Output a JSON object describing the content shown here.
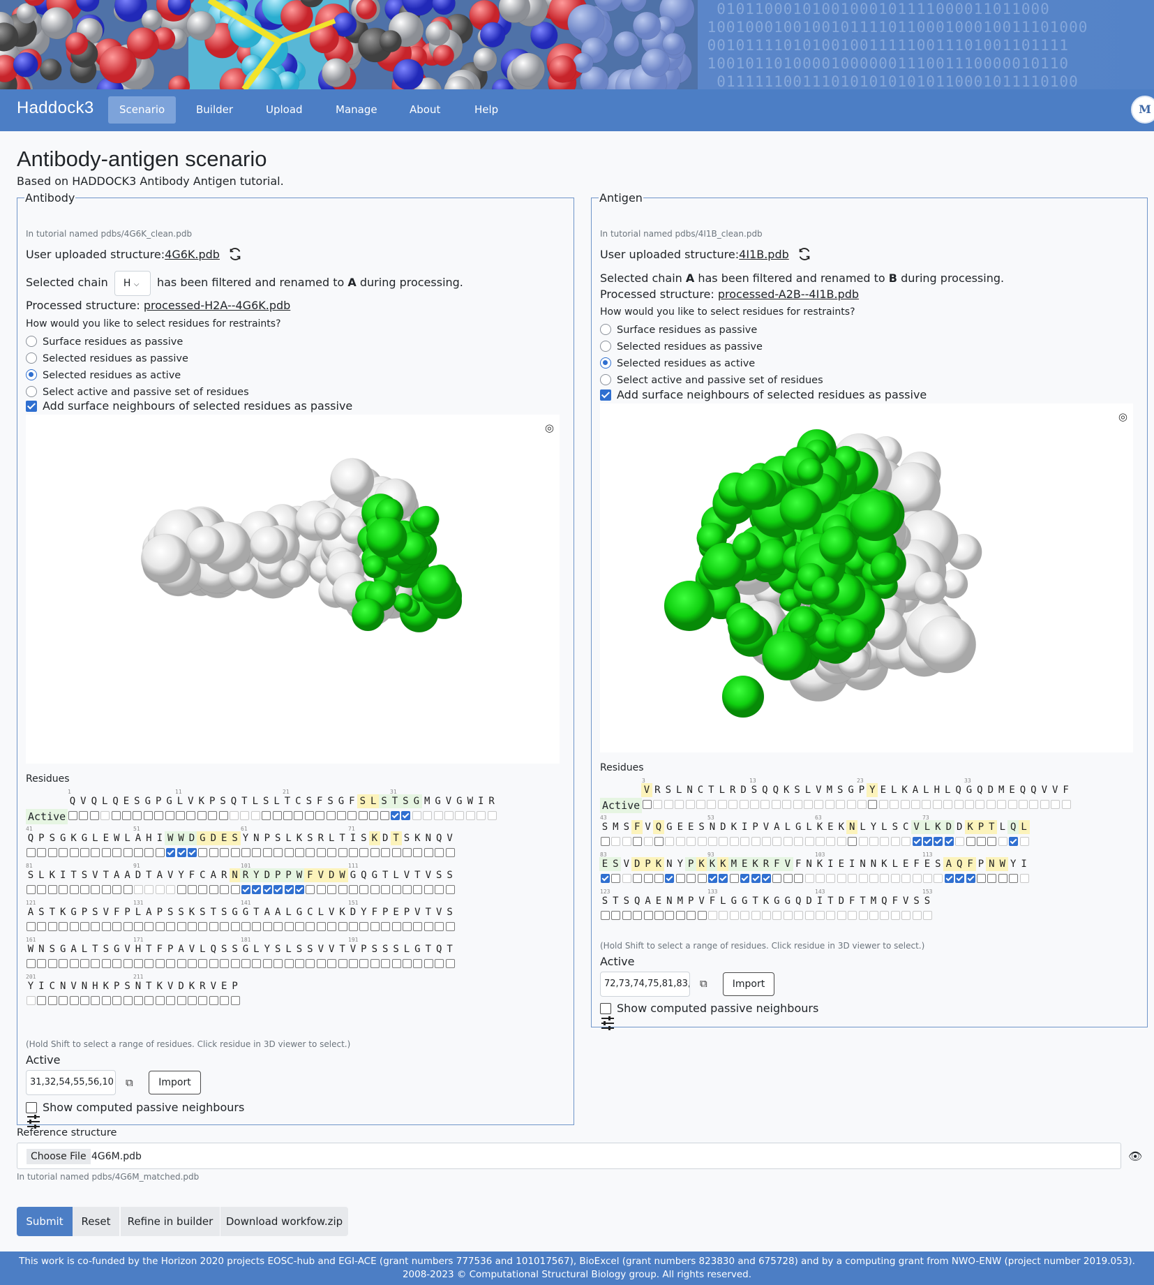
{
  "app": {
    "brand": "Haddock3",
    "avatar_initial": "M"
  },
  "nav": {
    "items": [
      "Scenario",
      "Builder",
      "Upload",
      "Manage",
      "About",
      "Help"
    ],
    "active": "Scenario"
  },
  "page": {
    "title": "Antibody-antigen scenario",
    "subtitle": "Based on HADDOCK3 Antibody Antigen tutorial."
  },
  "antibody": {
    "legend": "Antibody",
    "tutorial_hint": "In tutorial named pdbs/4G6K_clean.pdb",
    "uploaded_label": "User uploaded structure:",
    "uploaded_file": "4G6K.pdb",
    "chain_prefix": "Selected chain",
    "chain_value": "H",
    "chain_suffix": "has been filtered and renamed to",
    "chain_renamed": "A",
    "chain_tail": "during processing.",
    "processed_label": "Processed structure:",
    "processed_file": "processed-H2A--4G6K.pdb",
    "question": "How would you like to select residues for restraints?",
    "options": [
      "Surface residues as passive",
      "Selected residues as passive",
      "Selected residues as active",
      "Select active and passive set of residues"
    ],
    "selected_option": 2,
    "neighbours_label": "Add surface neighbours of selected residues as passive",
    "neighbours_checked": true,
    "residues_label": "Residues",
    "active_row_label": "Active",
    "shift_hint": "(Hold Shift to select a range of residues. Click residue in 3D viewer to select.)",
    "active_label": "Active",
    "active_value": "31,32,54,55,56,10",
    "import_label": "Import",
    "show_passive_label": "Show computed passive neighbours",
    "show_passive_checked": false,
    "sequence_rows": [
      {
        "start": 1,
        "seq": "QVQLQESGPGLVKPSQTLSLTCSFSGFSLSTSGMGVGWIR",
        "yellow": [
          28,
          29
        ],
        "green": [
          30,
          31,
          32,
          33
        ],
        "selected": [
          31,
          32
        ],
        "disabled": [
          4,
          16,
          17,
          18,
          33,
          34,
          35,
          36,
          37,
          38,
          39,
          40
        ]
      },
      {
        "start": 41,
        "seq": "QPSGKGLEWLAHIWWDGDESYNPSLKSRLTISKDTSKNQV",
        "yellow": [
          57,
          58,
          59,
          60,
          73,
          75
        ],
        "green": [
          54,
          55,
          56
        ],
        "selected": [
          54,
          55,
          56
        ],
        "disabled": []
      },
      {
        "start": 81,
        "seq": "SLKITSVTAADTAVYFCARNRYDPPWFVDWGQGTLVTVSS",
        "yellow": [
          100,
          107,
          108,
          109,
          110
        ],
        "green": [
          101,
          102,
          103,
          104,
          105,
          106
        ],
        "selected": [
          101,
          102,
          103,
          104,
          105,
          106
        ],
        "disabled": [
          91,
          92,
          93,
          94
        ]
      },
      {
        "start": 121,
        "seq": "ASTKGPSVFPLAPSSKSTSGGTAALGCLVKDYFPEPVTVS",
        "yellow": [],
        "green": [],
        "selected": [],
        "disabled": []
      },
      {
        "start": 161,
        "seq": "WNSGALTSGVHTFPAVLQSSGLYSLSSVVTVPSSSLGTQT",
        "yellow": [],
        "green": [],
        "selected": [],
        "disabled": []
      },
      {
        "start": 201,
        "seq": "YICNVNHKPSNTKVDKRVEP",
        "yellow": [],
        "green": [],
        "selected": [],
        "disabled": [
          201
        ]
      }
    ]
  },
  "antigen": {
    "legend": "Antigen",
    "tutorial_hint": "In tutorial named pdbs/4I1B_clean.pdb",
    "uploaded_label": "User uploaded structure:",
    "uploaded_file": "4I1B.pdb",
    "chain_prefix": "Selected chain",
    "chain_value": "A",
    "chain_suffix": "has been filtered and renamed to",
    "chain_renamed": "B",
    "chain_tail": "during processing.",
    "processed_label": "Processed structure:",
    "processed_file": "processed-A2B--4I1B.pdb",
    "question": "How would you like to select residues for restraints?",
    "options": [
      "Surface residues as passive",
      "Selected residues as passive",
      "Selected residues as active",
      "Select active and passive set of residues"
    ],
    "selected_option": 2,
    "neighbours_label": "Add surface neighbours of selected residues as passive",
    "neighbours_checked": true,
    "residues_label": "Residues",
    "active_row_label": "Active",
    "shift_hint": "(Hold Shift to select a range of residues. Click residue in 3D viewer to select.)",
    "active_label": "Active",
    "active_value": "72,73,74,75,81,83,",
    "import_label": "Import",
    "show_passive_label": "Show computed passive neighbours",
    "show_passive_checked": false,
    "sequence_rows": [
      {
        "start": 3,
        "seq": "VRSLNCTLRDSQQKSLVMSGPYELKALHLQGQDMEQQVVF",
        "yellow": [
          3,
          24
        ],
        "green": [],
        "selected": [],
        "disabled": [
          4,
          5,
          6,
          7,
          8,
          9,
          10,
          11,
          12,
          13,
          14,
          15,
          16,
          17,
          18,
          19,
          20,
          21,
          22,
          23,
          25,
          26,
          27,
          28,
          29,
          30,
          31,
          32,
          33,
          34,
          35,
          36,
          37,
          38,
          39,
          40,
          41,
          42
        ]
      },
      {
        "start": 43,
        "seq": "SMSFVQGEESNDKIPVALGLKEKNLYLSCVLKDDKPTLQL",
        "yellow": [
          46,
          48,
          66,
          77,
          78,
          79,
          82
        ],
        "green": [
          72,
          73,
          74,
          75,
          81
        ],
        "selected": [
          72,
          73,
          74,
          75,
          81
        ],
        "disabled": [
          44,
          45,
          47,
          49,
          50,
          51,
          52,
          53,
          54,
          55,
          56,
          57,
          58,
          59,
          60,
          61,
          62,
          63,
          64,
          65,
          67,
          68,
          69,
          70,
          71,
          76,
          80,
          82
        ]
      },
      {
        "start": 83,
        "seq": "ESVDPKNYPKKKMEKRFVFNKIEINNKLEFESAQFPNWYI",
        "yellow": [
          86,
          87,
          88,
          92,
          94,
          115,
          116,
          117,
          119,
          120
        ],
        "green": [
          83,
          84,
          91,
          93,
          95,
          96,
          97,
          98,
          99,
          100
        ],
        "selected": [
          83,
          89,
          93,
          94,
          96,
          97,
          98,
          115,
          116,
          117
        ],
        "disabled": [
          85,
          102,
          103,
          104,
          105,
          106,
          107,
          108,
          109,
          110,
          111,
          112,
          113,
          114,
          122
        ]
      },
      {
        "start": 123,
        "seq": "STSQAENMPVFLGGTKGGQDITDFTMQFVSS",
        "yellow": [],
        "green": [],
        "selected": [],
        "disabled": [
          133,
          134,
          135,
          136,
          137,
          138,
          139,
          140,
          141,
          142,
          143,
          144,
          145,
          146,
          147,
          148,
          149,
          150,
          151,
          152,
          153
        ]
      }
    ]
  },
  "reference": {
    "label": "Reference structure",
    "choose_file": "Choose File",
    "file_name": "4G6M.pdb",
    "tutorial_hint": "In tutorial named pdbs/4G6M_matched.pdb"
  },
  "actions": {
    "submit": "Submit",
    "reset": "Reset",
    "refine": "Refine in builder",
    "download": "Download workfow.zip"
  },
  "footer": {
    "line1": "This work is co-funded by the Horizon 2020 projects EOSC-hub and EGI-ACE (grant numbers 777536 and 101017567), BioExcel (grant numbers 823830 and 675728) and by a computing grant from NWO-ENW (project number 2019.053).",
    "line2": "2008-2023 © Computational Structural Biology group. All rights reserved."
  },
  "colors": {
    "navbar": "#4c7ec5",
    "active_tab": "#7da3da",
    "highlight_green": "#00e000",
    "checkbox_selected": "#2f6fd0"
  }
}
